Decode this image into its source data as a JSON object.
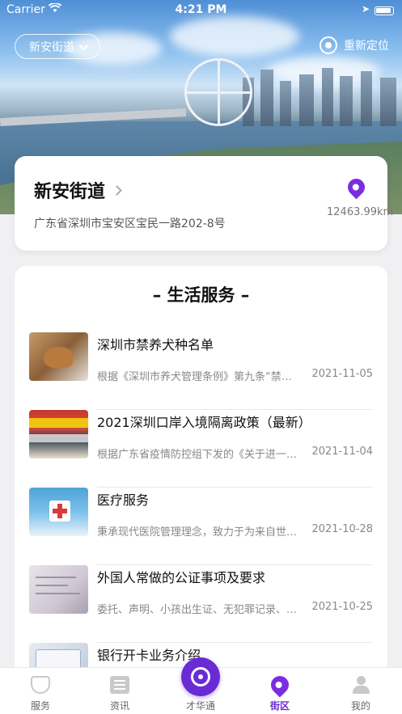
{
  "status_bar": {
    "carrier": "Carrier",
    "time": "4:21 PM"
  },
  "header": {
    "street_selector": "新安街道",
    "relocate": "重新定位"
  },
  "location_card": {
    "title": "新安街道",
    "address": "广东省深圳市宝安区宝民一路202-8号",
    "distance": "12463.99km"
  },
  "services": {
    "title": "– 生活服务 –",
    "items": [
      {
        "title": "深圳市禁养犬种名单",
        "summary": "根据《深圳市养犬管理条例》第九条“禁止…",
        "date": "2021-11-05"
      },
      {
        "title": "2021深圳口岸入境隔离政策（最新）",
        "summary": "根据广东省疫情防控组下发的《关于进一步…",
        "date": "2021-11-04"
      },
      {
        "title": "医疗服务",
        "summary": "秉承现代医院管理理念，致力于为来自世界…",
        "date": "2021-10-28"
      },
      {
        "title": "外国人常做的公证事项及要求",
        "summary": "委托、声明、小孩出生证、无犯罪记录、婚…",
        "date": "2021-10-25"
      },
      {
        "title": "银行开卡业务介绍",
        "summary": "",
        "date": ""
      }
    ]
  },
  "tabbar": {
    "items": [
      {
        "label": "服务",
        "icon": "service-icon"
      },
      {
        "label": "资讯",
        "icon": "news-icon"
      },
      {
        "label": "才华通",
        "icon": "talent-icon"
      },
      {
        "label": "街区",
        "icon": "location-pin-icon",
        "active": true
      },
      {
        "label": "我的",
        "icon": "profile-icon"
      }
    ],
    "accent": "#6a2bd6"
  }
}
